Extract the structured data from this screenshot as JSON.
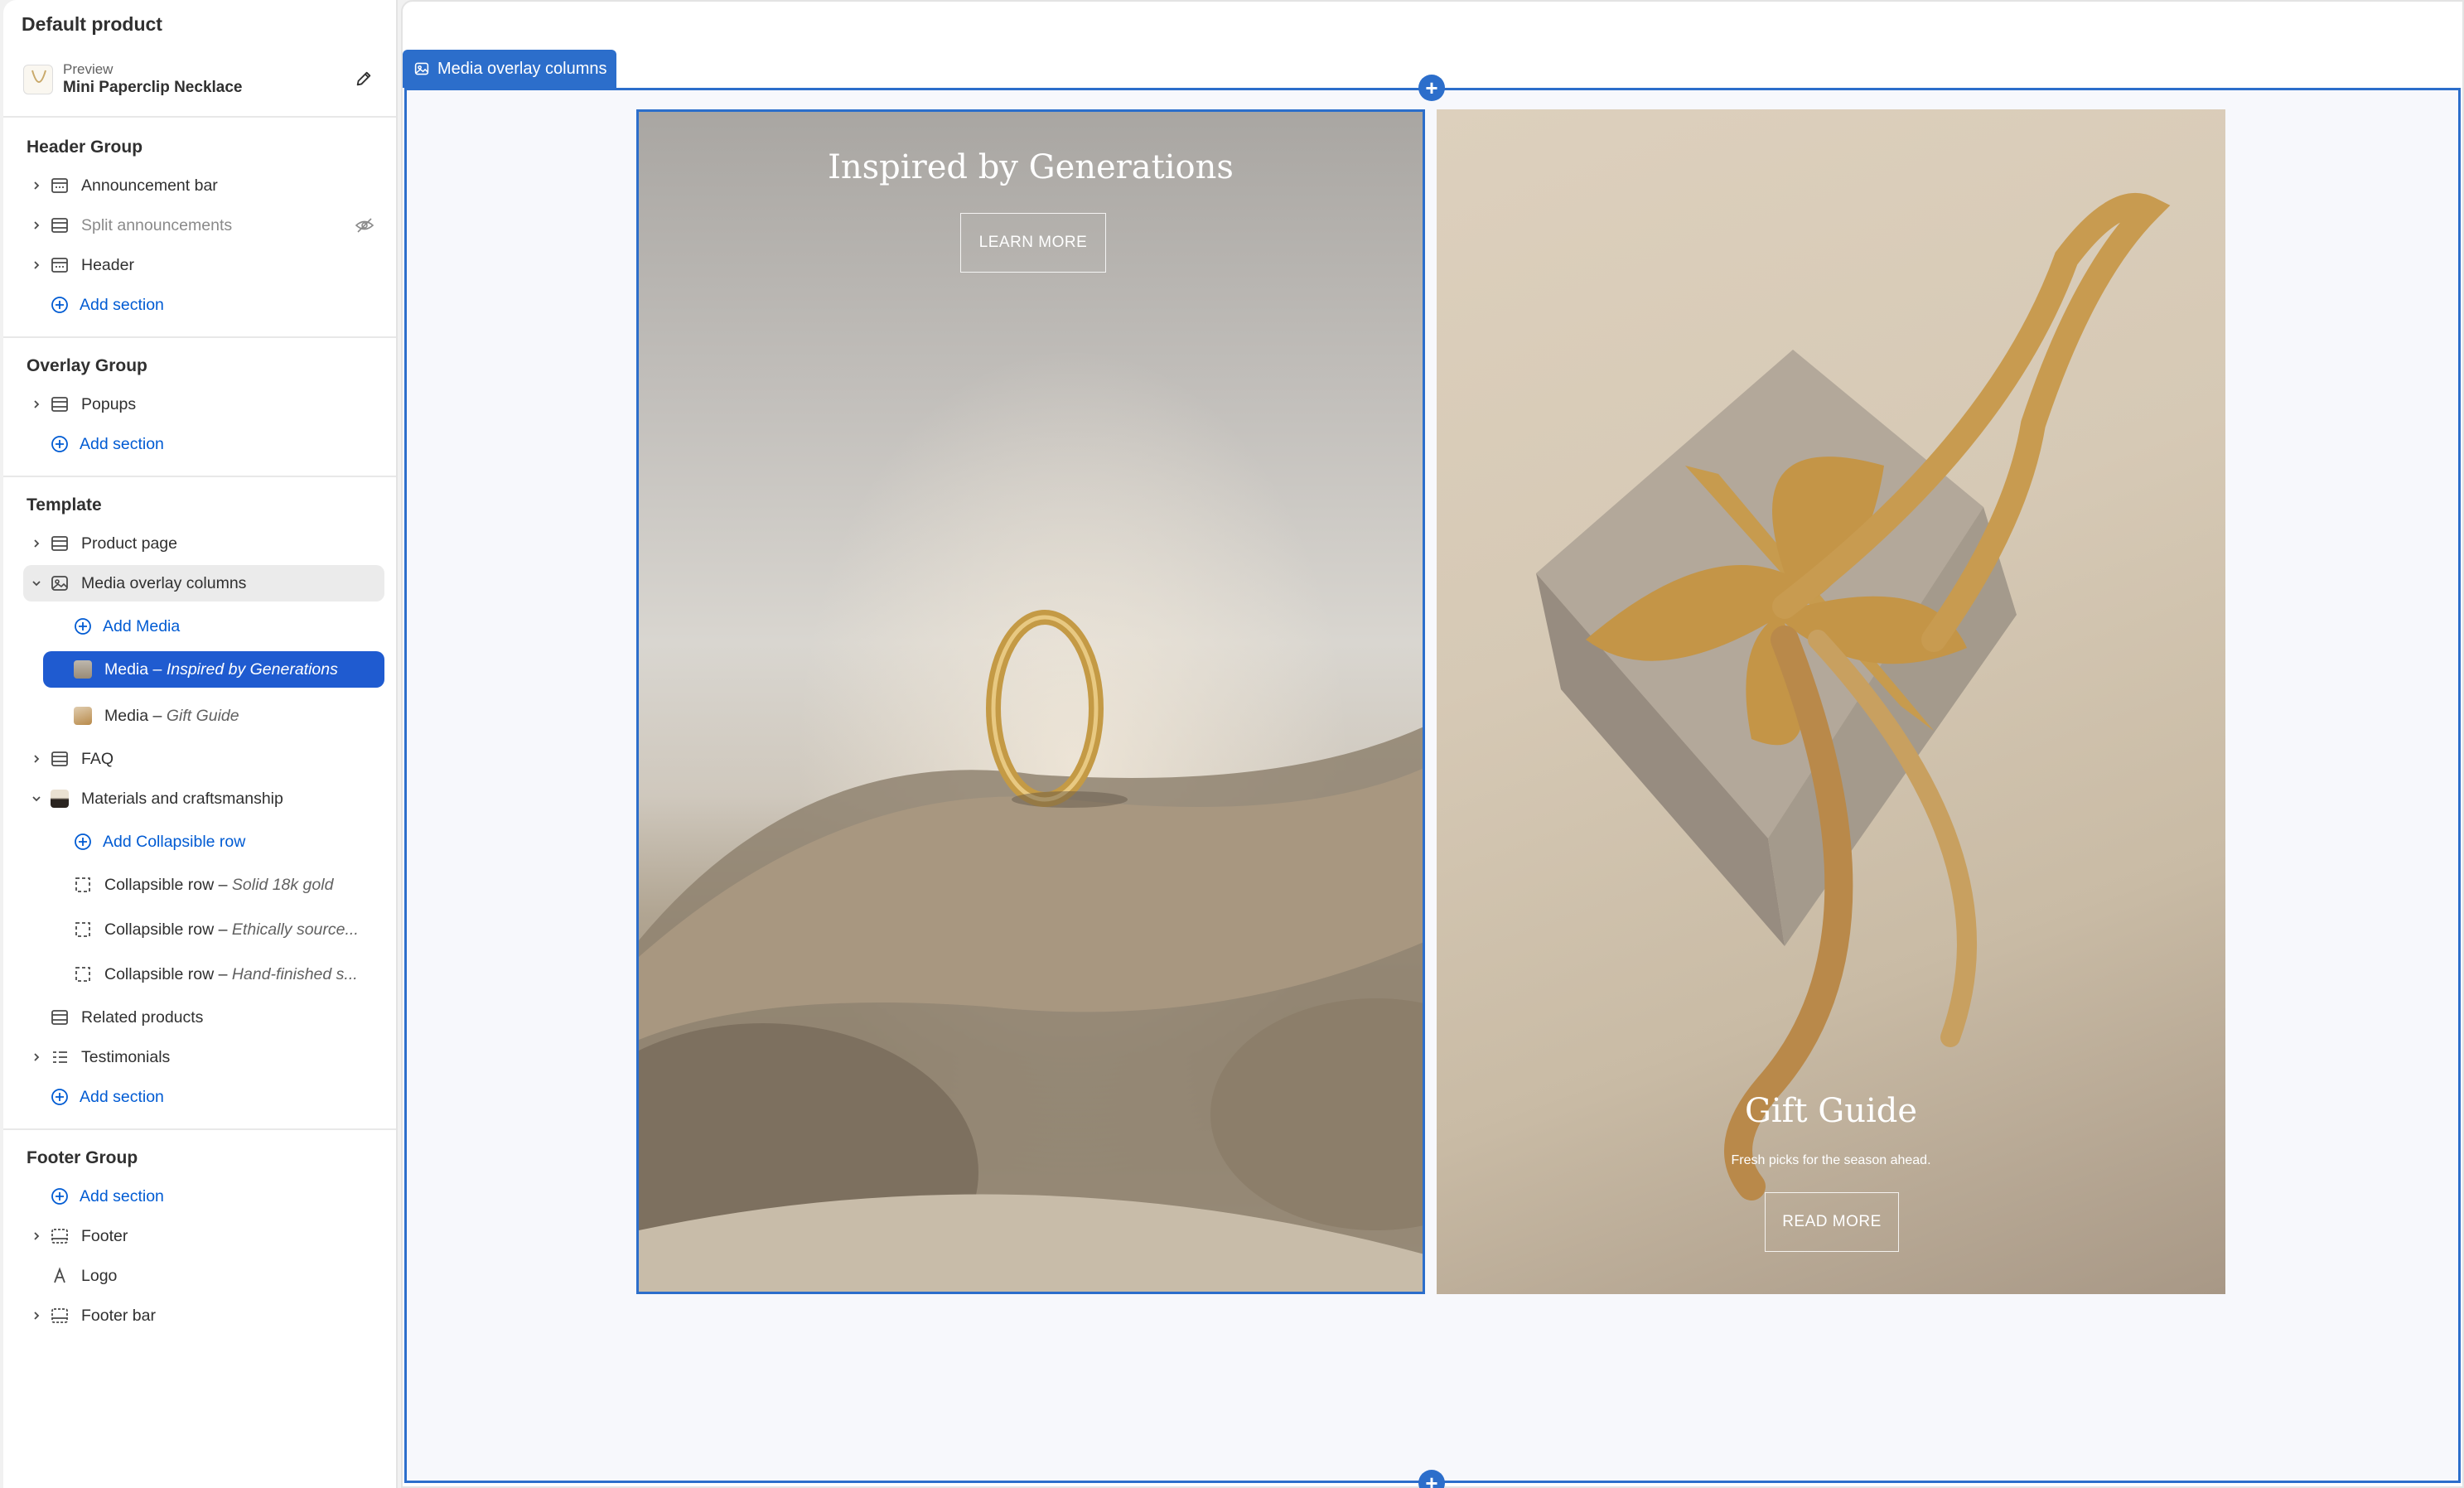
{
  "sidebar": {
    "title": "Default product",
    "preview": {
      "label": "Preview",
      "product": "Mini Paperclip Necklace"
    },
    "groups": {
      "header": {
        "title": "Header Group",
        "items": [
          "Announcement bar",
          "Split announcements",
          "Header"
        ],
        "add": "Add section"
      },
      "overlay": {
        "title": "Overlay Group",
        "items": [
          "Popups"
        ],
        "add": "Add section"
      },
      "template": {
        "title": "Template",
        "product_page": "Product page",
        "media_overlay": "Media overlay columns",
        "add_media": "Add Media",
        "media1": {
          "label": "Media",
          "sep": " – ",
          "detail": "Inspired by Generations"
        },
        "media2": {
          "label": "Media",
          "sep": " – ",
          "detail": "Gift Guide"
        },
        "faq": "FAQ",
        "materials": "Materials and craftsmanship",
        "add_collapsible": "Add Collapsible row",
        "rows": [
          {
            "label": "Collapsible row",
            "sep": " – ",
            "detail": "Solid 18k gold"
          },
          {
            "label": "Collapsible row",
            "sep": " – ",
            "detail": "Ethically source..."
          },
          {
            "label": "Collapsible row",
            "sep": " – ",
            "detail": "Hand-finished s..."
          }
        ],
        "related": "Related products",
        "testimonials": "Testimonials",
        "add": "Add section"
      },
      "footer": {
        "title": "Footer Group",
        "add": "Add section",
        "items": [
          "Footer",
          "Logo",
          "Footer bar"
        ]
      }
    }
  },
  "canvas": {
    "section_tag": "Media overlay columns",
    "media_left": {
      "title": "Inspired by Generations",
      "button": "LEARN MORE"
    },
    "media_right": {
      "title": "Gift Guide",
      "subtitle": "Fresh picks for the season ahead.",
      "button": "READ MORE"
    }
  },
  "colors": {
    "accent": "#2c6ecb",
    "selected_row": "#1f5bd0",
    "link": "#005bd3"
  }
}
